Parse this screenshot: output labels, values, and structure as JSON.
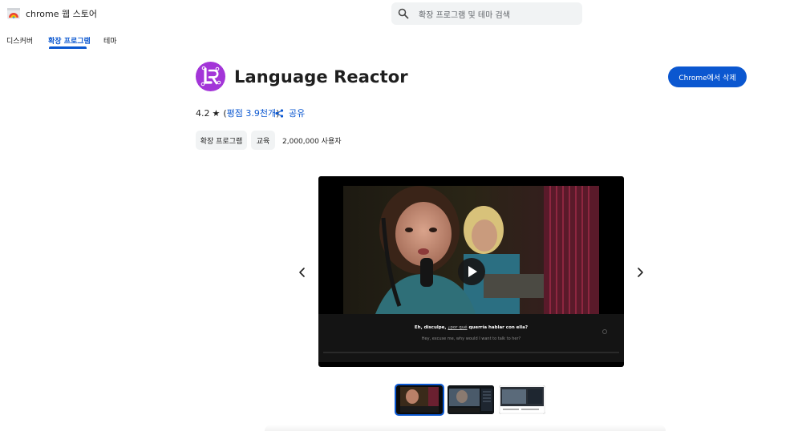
{
  "store": {
    "name": "chrome 웹 스토어",
    "search_placeholder": "확장 프로그램 및 테마 검색"
  },
  "nav": {
    "tabs": [
      {
        "label": "디스커버",
        "active": false
      },
      {
        "label": "확장 프로그램",
        "active": true
      },
      {
        "label": "테마",
        "active": false
      }
    ]
  },
  "extension": {
    "title": "Language Reactor",
    "install_label": "Chrome에서 삭제",
    "rating": "4.2",
    "star_icon": "★",
    "rating_link": "평점 3.9천개",
    "paren_open": "(",
    "paren_close": ")",
    "share_label": "공유",
    "chips": [
      "확장 프로그램",
      "교육"
    ],
    "users": "2,000,000 사용자"
  },
  "media": {
    "subtitle_es_prefix": "Eh, disculpe,",
    "subtitle_es_mid": "¿por qué",
    "subtitle_es_bold": "querría hablar con ella?",
    "subtitle_en": "Hey, excuse me, why would I want to talk to her?",
    "thumbnail_count": 3
  },
  "colors": {
    "accent": "#0b57d0",
    "icon_bg": "#a335d8",
    "chip_bg": "#f1f3f4"
  }
}
